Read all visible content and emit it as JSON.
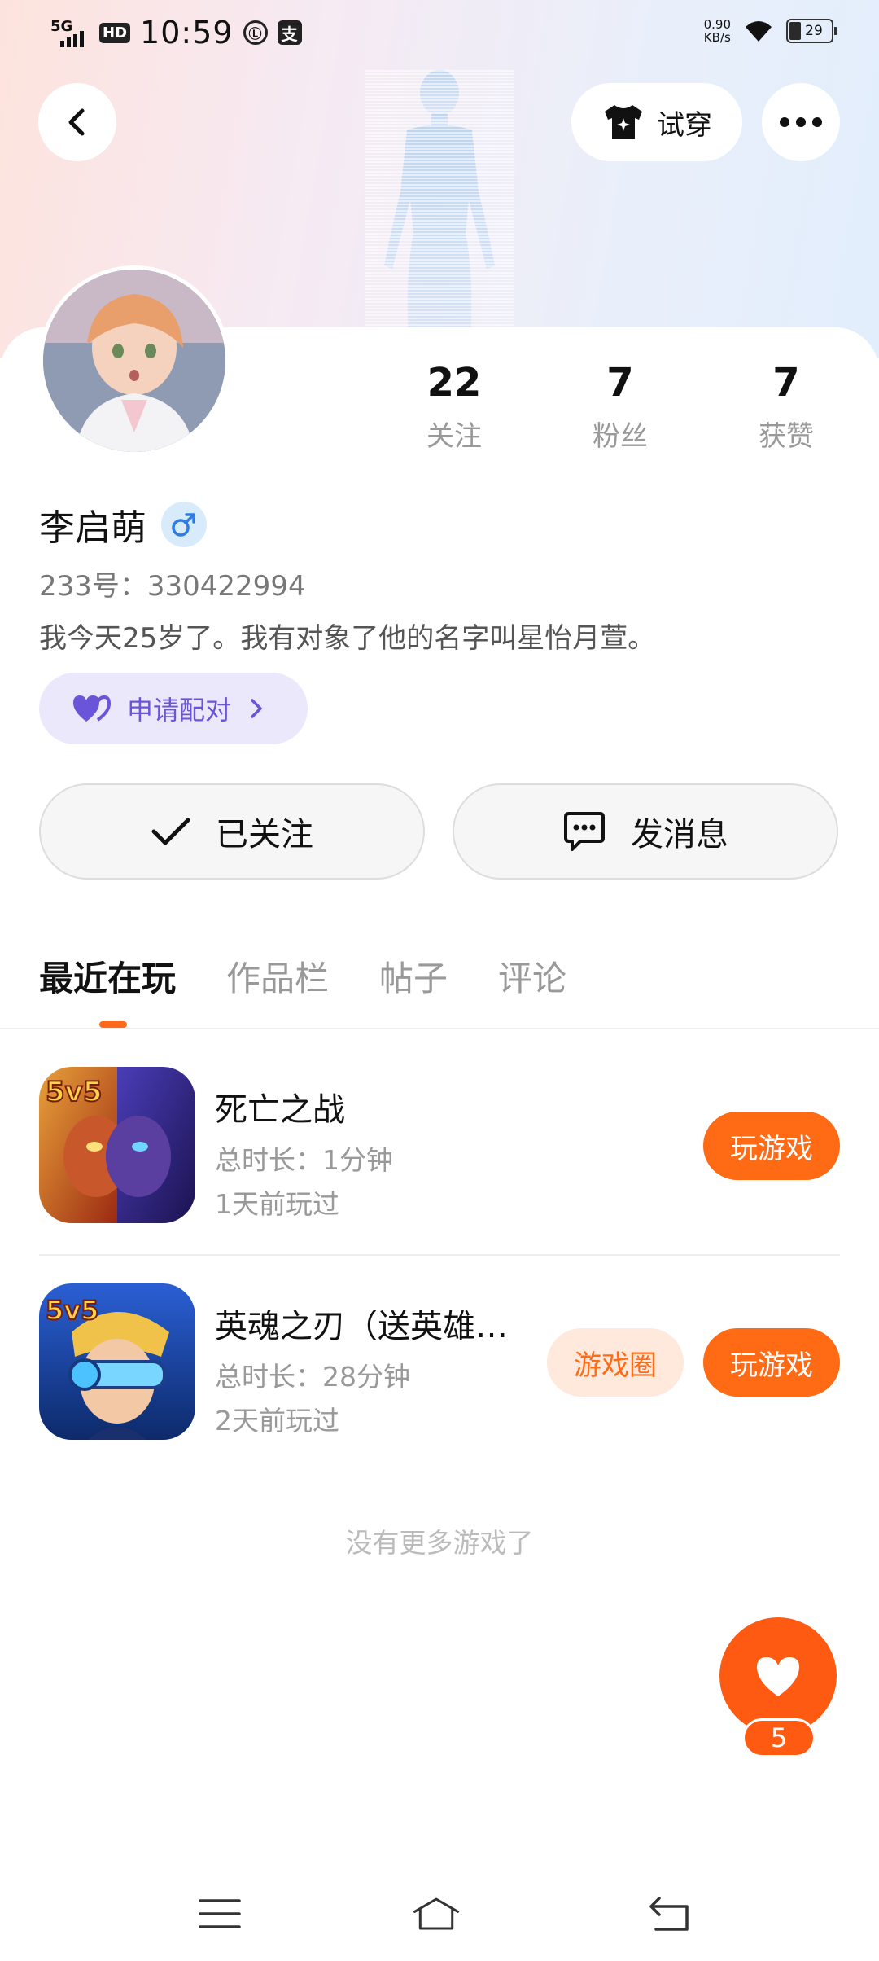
{
  "status_bar": {
    "network": "5G",
    "hd": "HD",
    "time": "10:59",
    "app_icon_1": "Ⓛ",
    "app_icon_2": "支",
    "speed_value": "0.90",
    "speed_unit": "KB/s",
    "battery": "29"
  },
  "header": {
    "back_icon": "chevron-left-icon",
    "try_on_label": "试穿",
    "try_on_icon": "tshirt-icon",
    "more_icon": "more-horizontal-icon"
  },
  "profile": {
    "stats": [
      {
        "value": "22",
        "label": "关注"
      },
      {
        "value": "7",
        "label": "粉丝"
      },
      {
        "value": "7",
        "label": "获赞"
      }
    ],
    "name": "李启萌",
    "gender_icon": "male-icon",
    "id_text": "233号：330422994",
    "bio": "我今天25岁了。我有对象了他的名字叫星怡月萱。",
    "pair_label": "申请配对"
  },
  "actions": {
    "follow_label": "已关注",
    "message_label": "发消息"
  },
  "tabs": [
    {
      "label": "最近在玩",
      "active": true
    },
    {
      "label": "作品栏",
      "active": false
    },
    {
      "label": "帖子",
      "active": false
    },
    {
      "label": "评论",
      "active": false
    }
  ],
  "games": [
    {
      "title": "死亡之战",
      "duration": "总时长：1分钟",
      "last_played": "1天前玩过",
      "play_label": "玩游戏"
    },
    {
      "title": "英魂之刃（送英雄…",
      "duration": "总时长：28分钟",
      "last_played": "2天前玩过",
      "circle_label": "游戏圈",
      "play_label": "玩游戏"
    }
  ],
  "no_more_text": "没有更多游戏了",
  "like_fab": {
    "count": "5",
    "icon": "heart-icon"
  },
  "colors": {
    "accent": "#ff6a14",
    "pair": "#6a55d8",
    "gender_bg": "#d8ebfb"
  }
}
